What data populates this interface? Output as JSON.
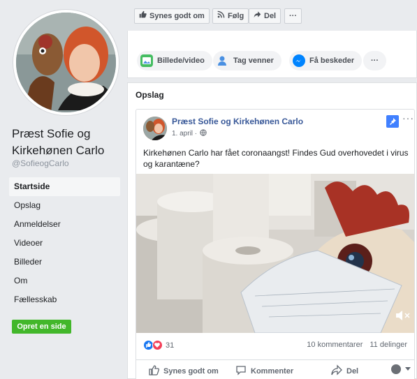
{
  "top_actions": {
    "like": "Synes godt om",
    "follow": "Følg",
    "share": "Del",
    "more": "···"
  },
  "composer": {
    "photo_video": "Billede/video",
    "tag_friends": "Tag venner",
    "get_messages": "Få beskeder",
    "more": "···"
  },
  "sidebar": {
    "page_name": "Præst Sofie og Kirkehønen Carlo",
    "handle": "@SofieogCarlo",
    "items": [
      {
        "label": "Startside",
        "active": true
      },
      {
        "label": "Opslag"
      },
      {
        "label": "Anmeldelser"
      },
      {
        "label": "Videoer"
      },
      {
        "label": "Billeder"
      },
      {
        "label": "Om"
      },
      {
        "label": "Fællesskab"
      }
    ],
    "create_page": "Opret en side"
  },
  "posts": {
    "section_title": "Opslag",
    "post": {
      "author": "Præst Sofie og Kirkehønen Carlo",
      "date": "1. april ·",
      "text": "Kirkehønen Carlo har fået coronaangst! Findes Gud overhovedet i virus og karantæne?",
      "reaction_count": "31",
      "comments": "10 kommentarer",
      "shares": "11 delinger",
      "actions": {
        "like": "Synes godt om",
        "comment": "Kommenter",
        "share": "Del"
      }
    }
  },
  "colors": {
    "link_blue": "#385898",
    "create_green": "#42b72a",
    "pin_blue": "#4080ff",
    "like_blue": "#1877f2",
    "love_red": "#f33e58"
  }
}
